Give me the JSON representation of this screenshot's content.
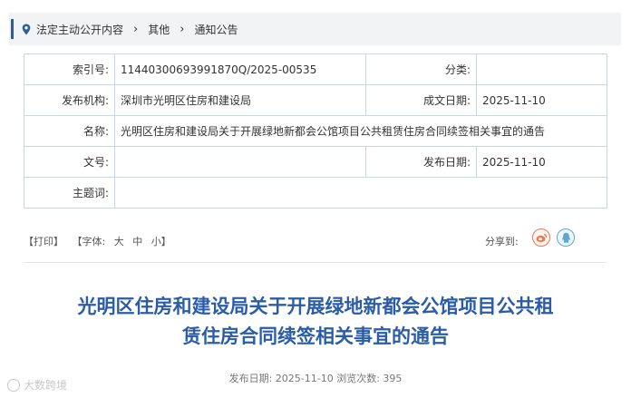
{
  "breadcrumb": {
    "items": [
      "法定主动公开内容",
      "其他",
      "通知公告"
    ]
  },
  "meta": {
    "index_label": "索引号:",
    "index_value": "11440300693991870Q/2025-00535",
    "category_label": "分类:",
    "category_value": "",
    "publisher_label": "发布机构:",
    "publisher_value": "深圳市光明区住房和建设局",
    "created_label": "成文日期:",
    "created_value": "2025-11-10",
    "name_label": "名称:",
    "name_value": "光明区住房和建设局关于开展绿地新都会公馆项目公共租赁住房合同续签相关事宜的通告",
    "docno_label": "文号:",
    "docno_value": "",
    "pubdate_label": "发布日期:",
    "pubdate_value": "2025-11-10",
    "subject_label": "主题词:",
    "subject_value": ""
  },
  "tools": {
    "print": "【打印】",
    "font_prefix": "【字体:",
    "font_large": "大",
    "font_medium": "中",
    "font_small": "小】",
    "share_label": "分享到:"
  },
  "article": {
    "title_line1": "光明区住房和建设局关于开展绿地新都会公馆项目公共租",
    "title_line2": "赁住房合同续签相关事宜的通告",
    "pub_info": "发布日期: 2025-11-10  浏览次数: 395"
  },
  "watermark": {
    "text": "大数跨境"
  },
  "colors": {
    "accent": "#2f5d97",
    "title": "#2a5ca8",
    "border": "#cbd6e3"
  }
}
